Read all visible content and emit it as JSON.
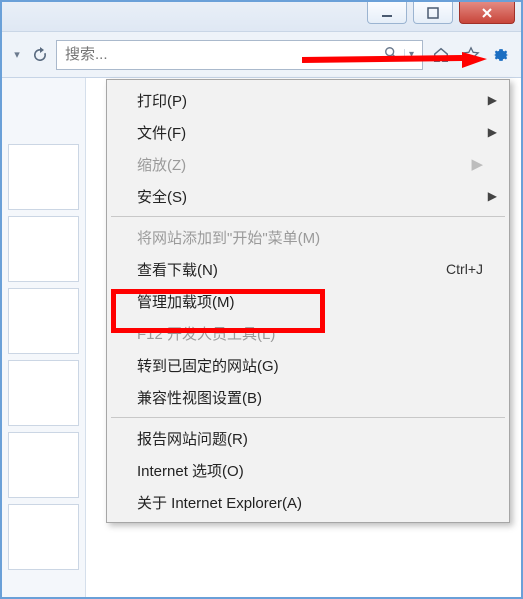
{
  "search": {
    "placeholder": "搜索..."
  },
  "menu": {
    "print": "打印(P)",
    "file": "文件(F)",
    "zoom": "缩放(Z)",
    "security": "安全(S)",
    "add_to_start": "将网站添加到\"开始\"菜单(M)",
    "view_downloads": "查看下载(N)",
    "view_downloads_shortcut": "Ctrl+J",
    "manage_addons": "管理加载项(M)",
    "f12_tools": "F12 开发人员工具(L)",
    "pinned_sites": "转到已固定的网站(G)",
    "compat_view": "兼容性视图设置(B)",
    "report_problem": "报告网站问题(R)",
    "internet_options": "Internet 选项(O)",
    "about": "关于 Internet Explorer(A)"
  }
}
